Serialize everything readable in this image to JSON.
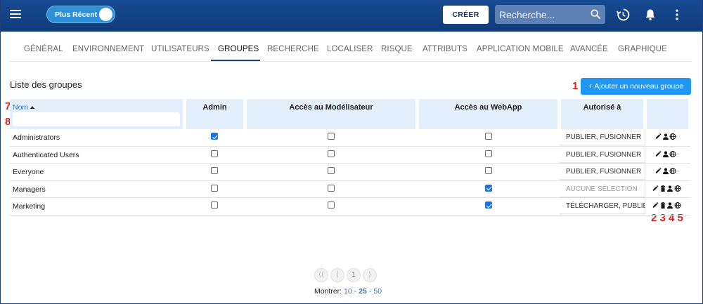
{
  "topbar": {
    "toggle_label": "Plus Récent",
    "create_label": "CRÉER",
    "search_placeholder": "Recherche..."
  },
  "tabs": [
    {
      "label": "GÉNÉRAL"
    },
    {
      "label": "ENVIRONNEMENT"
    },
    {
      "label": "UTILISATEURS"
    },
    {
      "label": "GROUPES",
      "active": true
    },
    {
      "label": "RECHERCHE"
    },
    {
      "label": "LOCALISER"
    },
    {
      "label": "RISQUE"
    },
    {
      "label": "ATTRIBUTS"
    },
    {
      "label": "APPLICATION MOBILE"
    },
    {
      "label": "AVANCÉE"
    },
    {
      "label": "GRAPHIQUE"
    }
  ],
  "list": {
    "title": "Liste des groupes",
    "add_button": "+ Ajouter un nouveau groupe"
  },
  "table": {
    "columns": {
      "name": "Nom",
      "admin": "Admin",
      "modeler": "Accès au Modélisateur",
      "webapp": "Accès au WebApp",
      "authorized": "Autorisé à"
    },
    "rows": [
      {
        "name": "Administrators",
        "admin": true,
        "modeler": false,
        "webapp": false,
        "authorized": "PUBLIER, FUSIONNER",
        "authorized_muted": false,
        "actions": [
          "edit-icon",
          "user-icon",
          "globe-icon"
        ]
      },
      {
        "name": "Authenticated Users",
        "admin": false,
        "modeler": false,
        "webapp": false,
        "authorized": "PUBLIER, FUSIONNER",
        "authorized_muted": false,
        "actions": [
          "edit-icon",
          "user-icon",
          "globe-icon"
        ]
      },
      {
        "name": "Everyone",
        "admin": false,
        "modeler": false,
        "webapp": false,
        "authorized": "PUBLIER, FUSIONNER",
        "authorized_muted": false,
        "actions": [
          "edit-icon",
          "user-icon",
          "globe-icon"
        ]
      },
      {
        "name": "Managers",
        "admin": false,
        "modeler": false,
        "webapp": true,
        "authorized": "AUCUNE SÉLECTION",
        "authorized_muted": true,
        "actions": [
          "edit-icon",
          "trash-icon",
          "user-icon",
          "globe-icon"
        ]
      },
      {
        "name": "Marketing",
        "admin": false,
        "modeler": false,
        "webapp": true,
        "authorized": "TÉLÉCHARGER, PUBLIER",
        "authorized_muted": false,
        "actions": [
          "edit-icon",
          "trash-icon",
          "user-icon",
          "globe-icon"
        ]
      }
    ]
  },
  "annotations": {
    "one": "1",
    "seven": "7",
    "eight": "8",
    "actions_numbers": "2 3 4 5"
  },
  "pagination": {
    "first": "⟨⟨",
    "prev": "⟨",
    "current": "1",
    "next": "⟩",
    "show_label": "Montrer:",
    "sizes": [
      "10",
      "25",
      "50"
    ],
    "selected_size": "25"
  },
  "colors": {
    "header": "#174a92",
    "accent": "#2196f3",
    "annotation": "#e02020",
    "table_header_bg": "#e3effb"
  }
}
